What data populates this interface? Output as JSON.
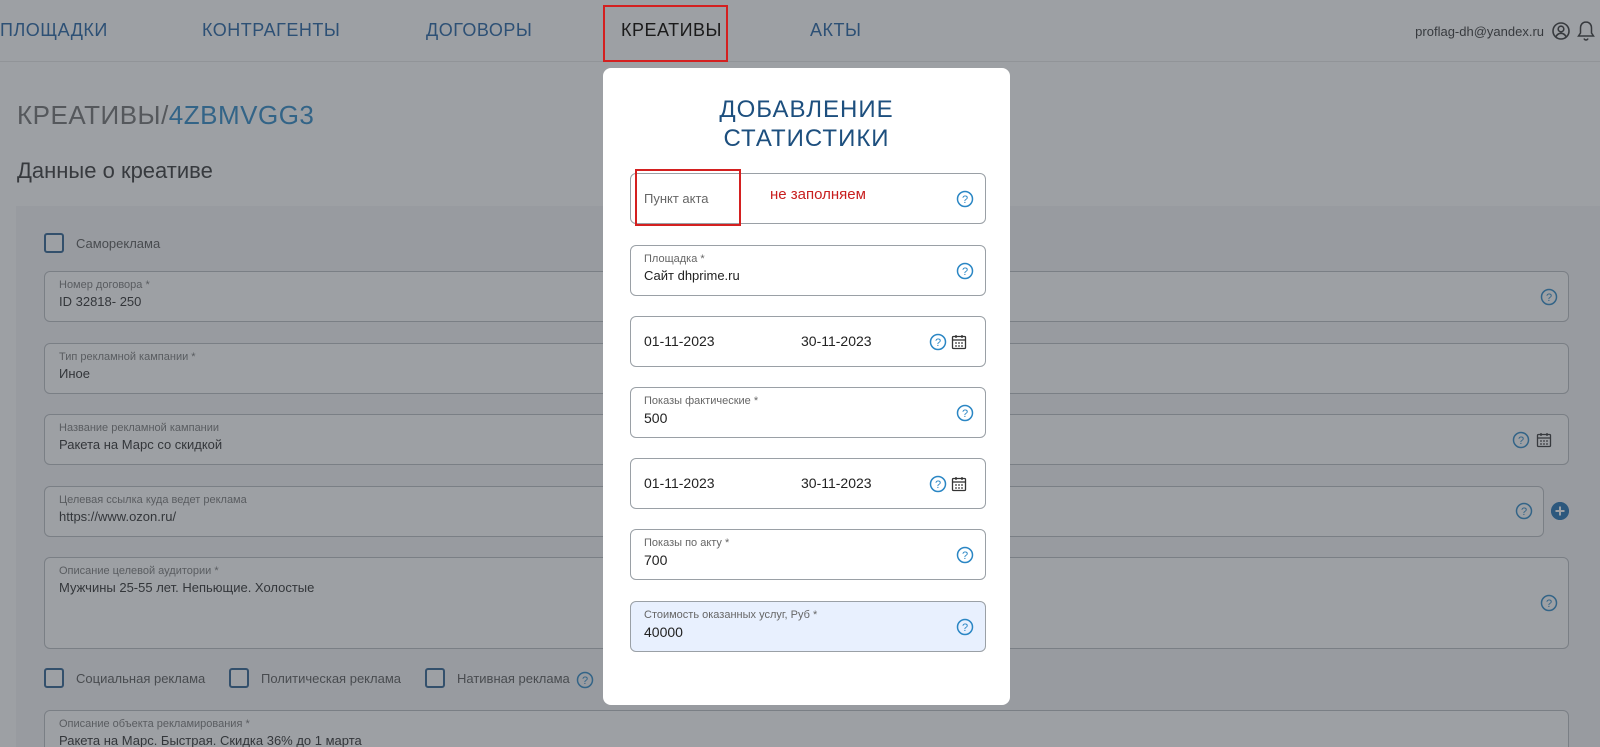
{
  "nav": {
    "items": [
      "ПЛОЩАДКИ",
      "КОНТРАГЕНТЫ",
      "ДОГОВОРЫ",
      "КРЕАТИВЫ",
      "АКТЫ"
    ],
    "active": "КРЕАТИВЫ",
    "user_email": "proflag-dh@yandex.ru"
  },
  "page": {
    "breadcrumb_root": "КРЕАТИВЫ/",
    "breadcrumb_id": "4ZBMVGG3",
    "section_title": "Данные о креативе"
  },
  "form": {
    "self_ad_label": "Самореклама",
    "contract": {
      "label": "Номер договора *",
      "value": "ID 32818- 250"
    },
    "campaign_type": {
      "label": "Тип рекламной кампании *",
      "value": "Иное"
    },
    "campaign_name": {
      "label": "Название рекламной кампании",
      "value": "Ракета на Марс со скидкой"
    },
    "target_link": {
      "label": "Целевая ссылка куда ведет реклама",
      "value": "https://www.ozon.ru/"
    },
    "audience": {
      "label": "Описание целевой аудитории *",
      "value": "Мужчины 25-55 лет. Непьющие. Холостые"
    },
    "checkboxes": [
      "Социальная реклама",
      "Политическая реклама",
      "Нативная реклама"
    ],
    "object_desc": {
      "label": "Описание объекта рекламирования *",
      "value": "Ракета на Марс. Быстрая. Скидка 36% до 1 марта"
    }
  },
  "modal": {
    "title_line1": "ДОБАВЛЕНИЕ",
    "title_line2": "СТАТИСТИКИ",
    "act_item_placeholder": "Пункт акта",
    "annotation": "не заполняем",
    "platform": {
      "label": "Площадка *",
      "value": "Сайт dhprime.ru"
    },
    "period1": {
      "from": "01-11-2023",
      "to": "30-11-2023"
    },
    "impressions_actual": {
      "label": "Показы фактические *",
      "value": "500"
    },
    "period2": {
      "from": "01-11-2023",
      "to": "30-11-2023"
    },
    "impressions_act": {
      "label": "Показы по акту *",
      "value": "700"
    },
    "cost": {
      "label": "Стоимость оказанных услуг, Руб *",
      "value": "40000"
    }
  },
  "colors": {
    "accent": "#1e6fb0",
    "annotation_red": "#d42020",
    "modal_title": "#1d4f7e",
    "autofill_bg": "#e8f0fe"
  }
}
